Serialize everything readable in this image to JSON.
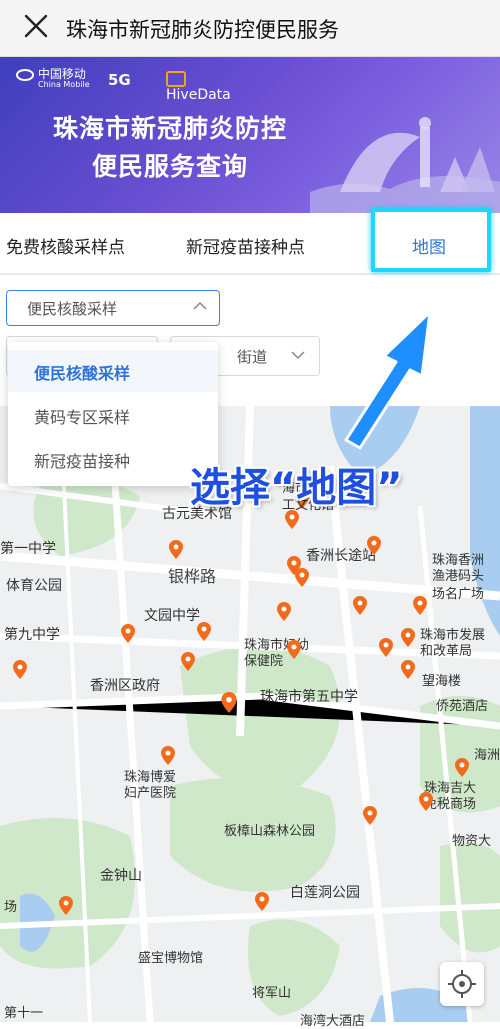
{
  "topbar": {
    "title": "珠海市新冠肺炎防控便民服务"
  },
  "banner": {
    "logo1_cn": "中国移动",
    "logo1_en": "China Mobile",
    "logo2": "5G",
    "logo3": "HiveData",
    "headline_line1": "珠海市新冠肺炎防控",
    "headline_line2": "便民服务查询"
  },
  "tabs": [
    {
      "label": "免费核酸采样点"
    },
    {
      "label": "新冠疫苗接种点"
    },
    {
      "label": "地图"
    }
  ],
  "filters": {
    "type_selected": "便民核酸采样",
    "street_selected": "街道"
  },
  "dropdown": {
    "options": [
      "便民核酸采样",
      "黄码专区采样",
      "新冠疫苗接种"
    ]
  },
  "annotation": "选择“地图”",
  "map": {
    "labels": [
      "海市社",
      "工文化馆",
      "古元美术馆",
      "第一中学",
      "香洲长途站",
      "珠海香洲",
      "渔港码头",
      "银桦路",
      "场名广场",
      "体育公园",
      "文园中学",
      "珠海市发展",
      "和改革局",
      "第九中学",
      "珠海市妇幼",
      "保健院",
      "望海楼",
      "香洲区政府",
      "珠海市第五中学",
      "侨苑酒店",
      "海洲",
      "珠海博爱",
      "妇产医院",
      "珠海吉大",
      "免税商场",
      "板樟山森林公园",
      "物资大",
      "金钟山",
      "白莲洞公园",
      "场",
      "盛宝博物馆",
      "将军山",
      "第十一",
      "海湾大酒店"
    ]
  },
  "colors": {
    "accent": "#2e74d8",
    "pin": "#f26b1d",
    "highlight": "#1fd6ff",
    "annotation": "#1e4fe0"
  }
}
